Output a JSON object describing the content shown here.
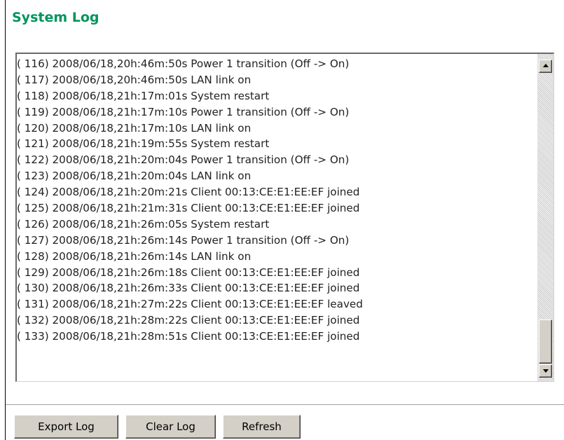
{
  "page": {
    "title": "System Log"
  },
  "log": {
    "lines": [
      "( 116) 2008/06/18,20h:46m:50s Power 1 transition (Off -> On)",
      "( 117) 2008/06/18,20h:46m:50s LAN link on",
      "( 118) 2008/06/18,21h:17m:01s System restart",
      "( 119) 2008/06/18,21h:17m:10s Power 1 transition (Off -> On)",
      "( 120) 2008/06/18,21h:17m:10s LAN link on",
      "( 121) 2008/06/18,21h:19m:55s System restart",
      "( 122) 2008/06/18,21h:20m:04s Power 1 transition (Off -> On)",
      "( 123) 2008/06/18,21h:20m:04s LAN link on",
      "( 124) 2008/06/18,21h:20m:21s Client 00:13:CE:E1:EE:EF joined",
      "( 125) 2008/06/18,21h:21m:31s Client 00:13:CE:E1:EE:EF joined",
      "( 126) 2008/06/18,21h:26m:05s System restart",
      "( 127) 2008/06/18,21h:26m:14s Power 1 transition (Off -> On)",
      "( 128) 2008/06/18,21h:26m:14s LAN link on",
      "( 129) 2008/06/18,21h:26m:18s Client 00:13:CE:E1:EE:EF joined",
      "( 130) 2008/06/18,21h:26m:33s Client 00:13:CE:E1:EE:EF joined",
      "( 131) 2008/06/18,21h:27m:22s Client 00:13:CE:E1:EE:EF leaved",
      "( 132) 2008/06/18,21h:28m:22s Client 00:13:CE:E1:EE:EF joined",
      "( 133) 2008/06/18,21h:28m:51s Client 00:13:CE:E1:EE:EF joined"
    ]
  },
  "buttons": {
    "export": "Export Log",
    "clear": "Clear Log",
    "refresh": "Refresh"
  },
  "colors": {
    "title": "#00955a"
  },
  "icons": {
    "scroll_up": "triangle-up",
    "scroll_down": "triangle-down"
  }
}
